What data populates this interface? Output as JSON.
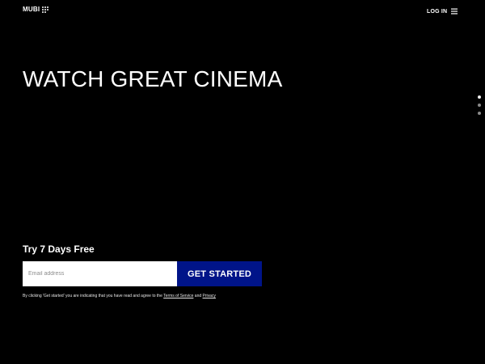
{
  "header": {
    "logo_text": "MUBI",
    "login_label": "LOG IN",
    "menu_icon": "hamburger-menu-icon"
  },
  "hero": {
    "title": "WATCH GREAT CINEMA",
    "slides": [
      true,
      false,
      false
    ]
  },
  "signup": {
    "trial_label": "Try 7 Days Free",
    "email_placeholder": "Email address",
    "email_value": "",
    "button_label": "GET STARTED",
    "button_color": "#001489",
    "disclaimer": {
      "text": "By clicking 'Get started' you are indicating that you have read and agree to the",
      "terms_label": "Terms of Service",
      "joiner": "and",
      "privacy_label": "Privacy"
    }
  },
  "colors": {
    "background": "#000000",
    "text": "#ffffff",
    "accent": "#001489"
  }
}
